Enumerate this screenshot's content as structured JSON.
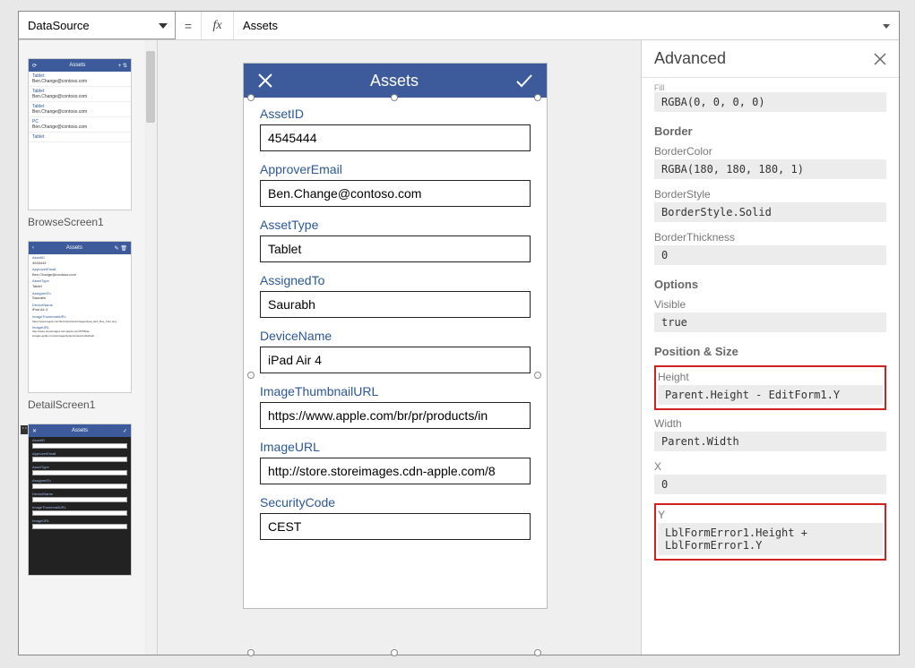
{
  "formulaBar": {
    "propertyName": "DataSource",
    "formula": "Assets"
  },
  "thumbnails": {
    "screen1": {
      "title": "Assets",
      "label": "BrowseScreen1",
      "rows": [
        {
          "t": "Tablet",
          "s": "Ben.Change@contoso.com"
        },
        {
          "t": "Tablet",
          "s": "Ben.Change@contoso.com"
        },
        {
          "t": "Tablet",
          "s": "Ben.Change@contoso.com"
        },
        {
          "t": "PC",
          "s": "Ben.Change@contoso.com"
        },
        {
          "t": "Tablet",
          "s": ""
        }
      ]
    },
    "screen2": {
      "title": "Assets",
      "label": "DetailScreen1",
      "rows": [
        "AssetID",
        "ApproverEmail",
        "AssetType",
        "AssignedTo",
        "DeviceName",
        "ImageThumbnailURL",
        "ImageURL"
      ]
    },
    "screen3": {
      "title": "Assets",
      "rows": [
        "AssetID",
        "ApproverEmail",
        "AssetType",
        "AssignedTo",
        "DeviceName",
        "ImageThumbnailURL",
        "ImageURL"
      ]
    }
  },
  "canvas": {
    "title": "Assets",
    "fields": [
      {
        "label": "AssetID",
        "value": "4545444"
      },
      {
        "label": "ApproverEmail",
        "value": "Ben.Change@contoso.com"
      },
      {
        "label": "AssetType",
        "value": "Tablet"
      },
      {
        "label": "AssignedTo",
        "value": "Saurabh"
      },
      {
        "label": "DeviceName",
        "value": "iPad Air 4"
      },
      {
        "label": "ImageThumbnailURL",
        "value": "https://www.apple.com/br/pr/products/in"
      },
      {
        "label": "ImageURL",
        "value": "http://store.storeimages.cdn-apple.com/8"
      },
      {
        "label": "SecurityCode",
        "value": "CEST"
      }
    ]
  },
  "props": {
    "title": "Advanced",
    "fillLabel": "Fill",
    "fillValue": "RGBA(0, 0, 0, 0)",
    "sections": {
      "border": {
        "title": "Border",
        "items": [
          {
            "label": "BorderColor",
            "value": "RGBA(180, 180, 180, 1)"
          },
          {
            "label": "BorderStyle",
            "value": "BorderStyle.Solid"
          },
          {
            "label": "BorderThickness",
            "value": "0"
          }
        ]
      },
      "options": {
        "title": "Options",
        "items": [
          {
            "label": "Visible",
            "value": "true"
          }
        ]
      },
      "pos": {
        "title": "Position & Size",
        "items": [
          {
            "label": "Height",
            "value": "Parent.Height - EditForm1.Y",
            "highlight": true
          },
          {
            "label": "Width",
            "value": "Parent.Width"
          },
          {
            "label": "X",
            "value": "0"
          },
          {
            "label": "Y",
            "value": "LblFormError1.Height + LblFormError1.Y",
            "highlight": true
          }
        ]
      }
    }
  }
}
